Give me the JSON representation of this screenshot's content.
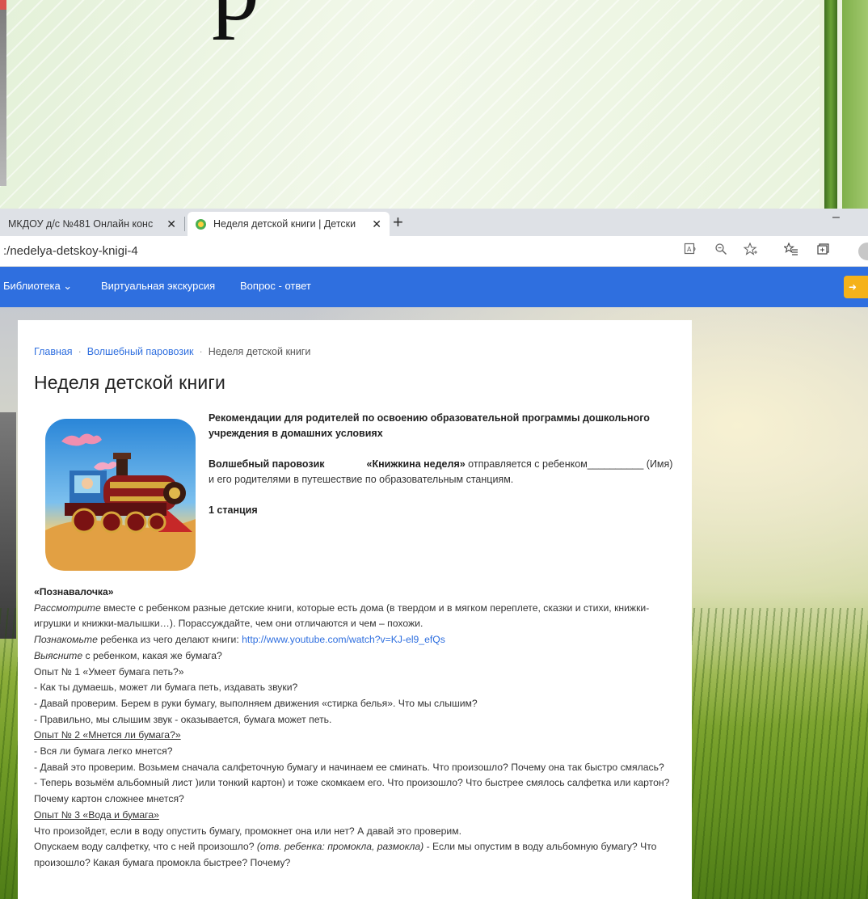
{
  "slide": {
    "glyph": "р"
  },
  "browser": {
    "tabs": [
      {
        "label": "МКДОУ д/с №481 Онлайн конс",
        "active": false
      },
      {
        "label": "Неделя детской книги | Детски",
        "active": true
      }
    ],
    "new_tab_symbol": "+",
    "minimize_symbol": "–",
    "close_symbol": "✕",
    "url": ":/nedelya-detskoy-knigi-4"
  },
  "site_nav": {
    "items": [
      "Библиотека ⌄",
      "Виртуальная экскурсия",
      "Вопрос - ответ"
    ],
    "login_symbol": "➜"
  },
  "page": {
    "breadcrumb": [
      "Главная",
      "Волшебный паровозик",
      "Неделя детской книги"
    ],
    "title": "Неделя детской книги",
    "intro": {
      "heading": "Рекомендации для родителей по освоению образовательной программы дошкольного учреждения в домашних условиях",
      "train_name": "Волшебный паровозик",
      "week_name": "«Книжкина неделя»",
      "trip_text": " отправляется с ребенком__________ (Имя) и его родителями в путешествие по образовательным станциям.",
      "station": "1 станция"
    },
    "body": {
      "section_title": "«Познавалочка»",
      "p1_em": "Рассмотрите",
      "p1_rest": " вместе с ребенком разные детские книги, которые есть дома (в твердом  и в  мягком переплете, сказки и стихи, книжки-игрушки и книжки-малышки…). Порассуждайте, чем они отличаются и чем – похожи.",
      "p2_em": "Познакомьте",
      "p2_rest": " ребенка  из чего делают книги: ",
      "p2_link": "http://www.youtube.com/watch?v=KJ-el9_efQs",
      "p3_em": "Выясните",
      "p3_rest": " с ребенком, какая же бумага?",
      "exp1_title": "Опыт № 1 «Умеет бумага петь?»",
      "exp1_l1": "- Как ты думаешь, может ли бумага петь, издавать звуки?",
      "exp1_l2": "- Давай проверим. Берем в руки бумагу, выполняем движения «стирка белья». Что мы слышим?",
      "exp1_l3": "- Правильно, мы слышим звук - оказывается, бумага может петь.",
      "exp2_title": "Опыт № 2 «Мнется ли бумага?»",
      "exp2_l1": "- Вся ли бумага легко мнется?",
      "exp2_l2": "- Давай это проверим. Возьмем сначала салфеточную бумагу и начинаем ее сминать. Что произошло? Почему она так быстро смялась?",
      "exp2_l3": "- Теперь возьмём альбомный лист )или тонкий картон) и тоже скомкаем его. Что произошло? Что быстрее смялось салфетка или картон? Почему картон сложнее мнется?",
      "exp3_title": "Опыт № 3 «Вода и бумага»",
      "exp3_l1": "Что произойдет, если в воду опустить бумагу, промокнет она или нет? А давай это проверим.",
      "exp3_l2a": "Опускаем воду салфетку, что с ней произошло? ",
      "exp3_l2_em": "(отв. ребенка: промокла, размокла)",
      "exp3_l2b": " - Если мы опустим в воду альбомную бумагу? Что произошло? Какая бумага промокла быстрее? Почему?"
    }
  }
}
